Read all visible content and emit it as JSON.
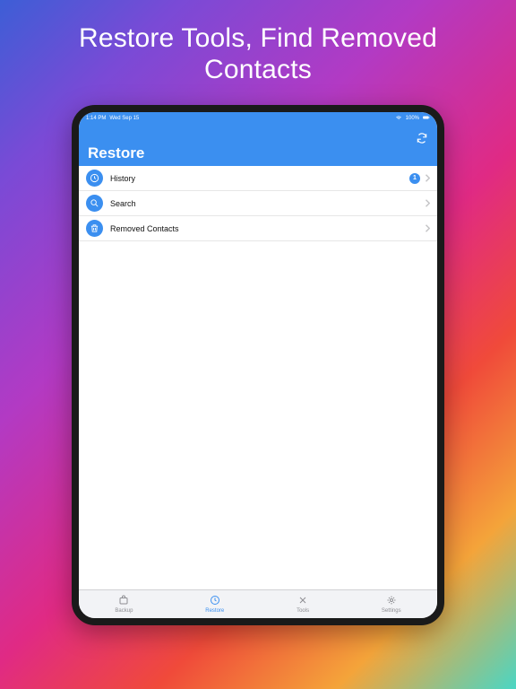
{
  "promo": {
    "line1": "Restore Tools, Find Removed",
    "line2": "Contacts"
  },
  "statusBar": {
    "time": "1:14 PM",
    "date": "Wed Sep 15",
    "battery": "100%"
  },
  "nav": {
    "title": "Restore"
  },
  "rows": [
    {
      "label": "History",
      "badge": "1"
    },
    {
      "label": "Search"
    },
    {
      "label": "Removed Contacts"
    }
  ],
  "tabs": [
    {
      "label": "Backup"
    },
    {
      "label": "Restore"
    },
    {
      "label": "Tools"
    },
    {
      "label": "Settings"
    }
  ]
}
